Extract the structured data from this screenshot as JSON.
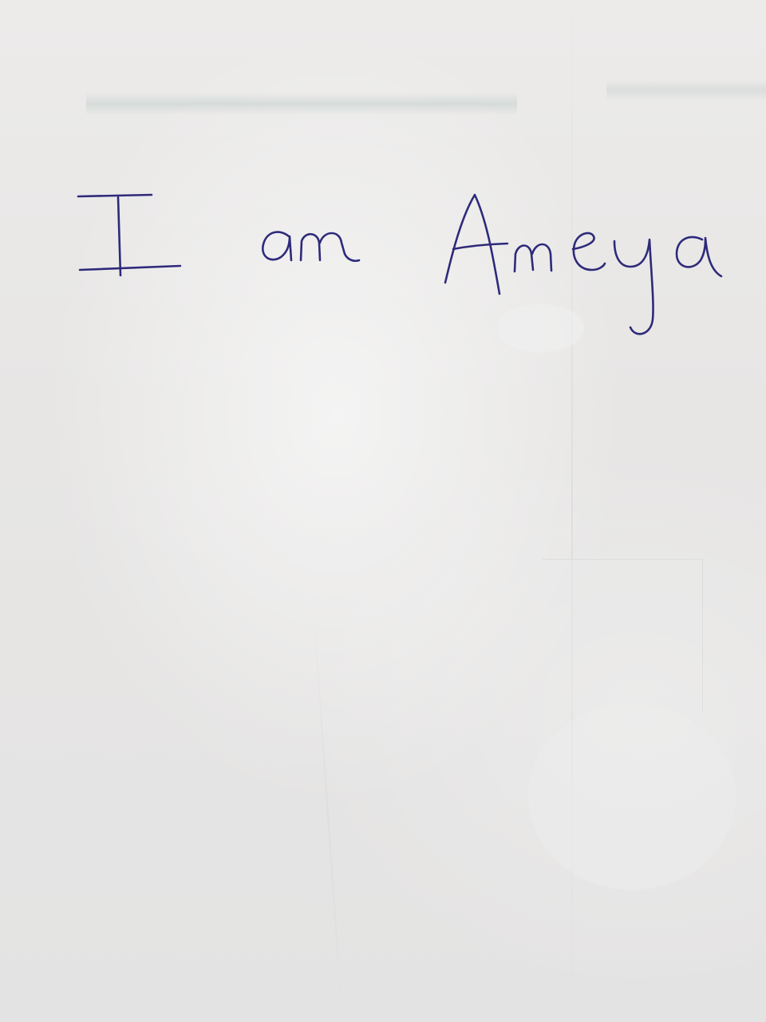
{
  "note": {
    "text": "I am Ameya",
    "ink_color": "#2e2a7a",
    "paper_color": "#e8e7e6"
  }
}
